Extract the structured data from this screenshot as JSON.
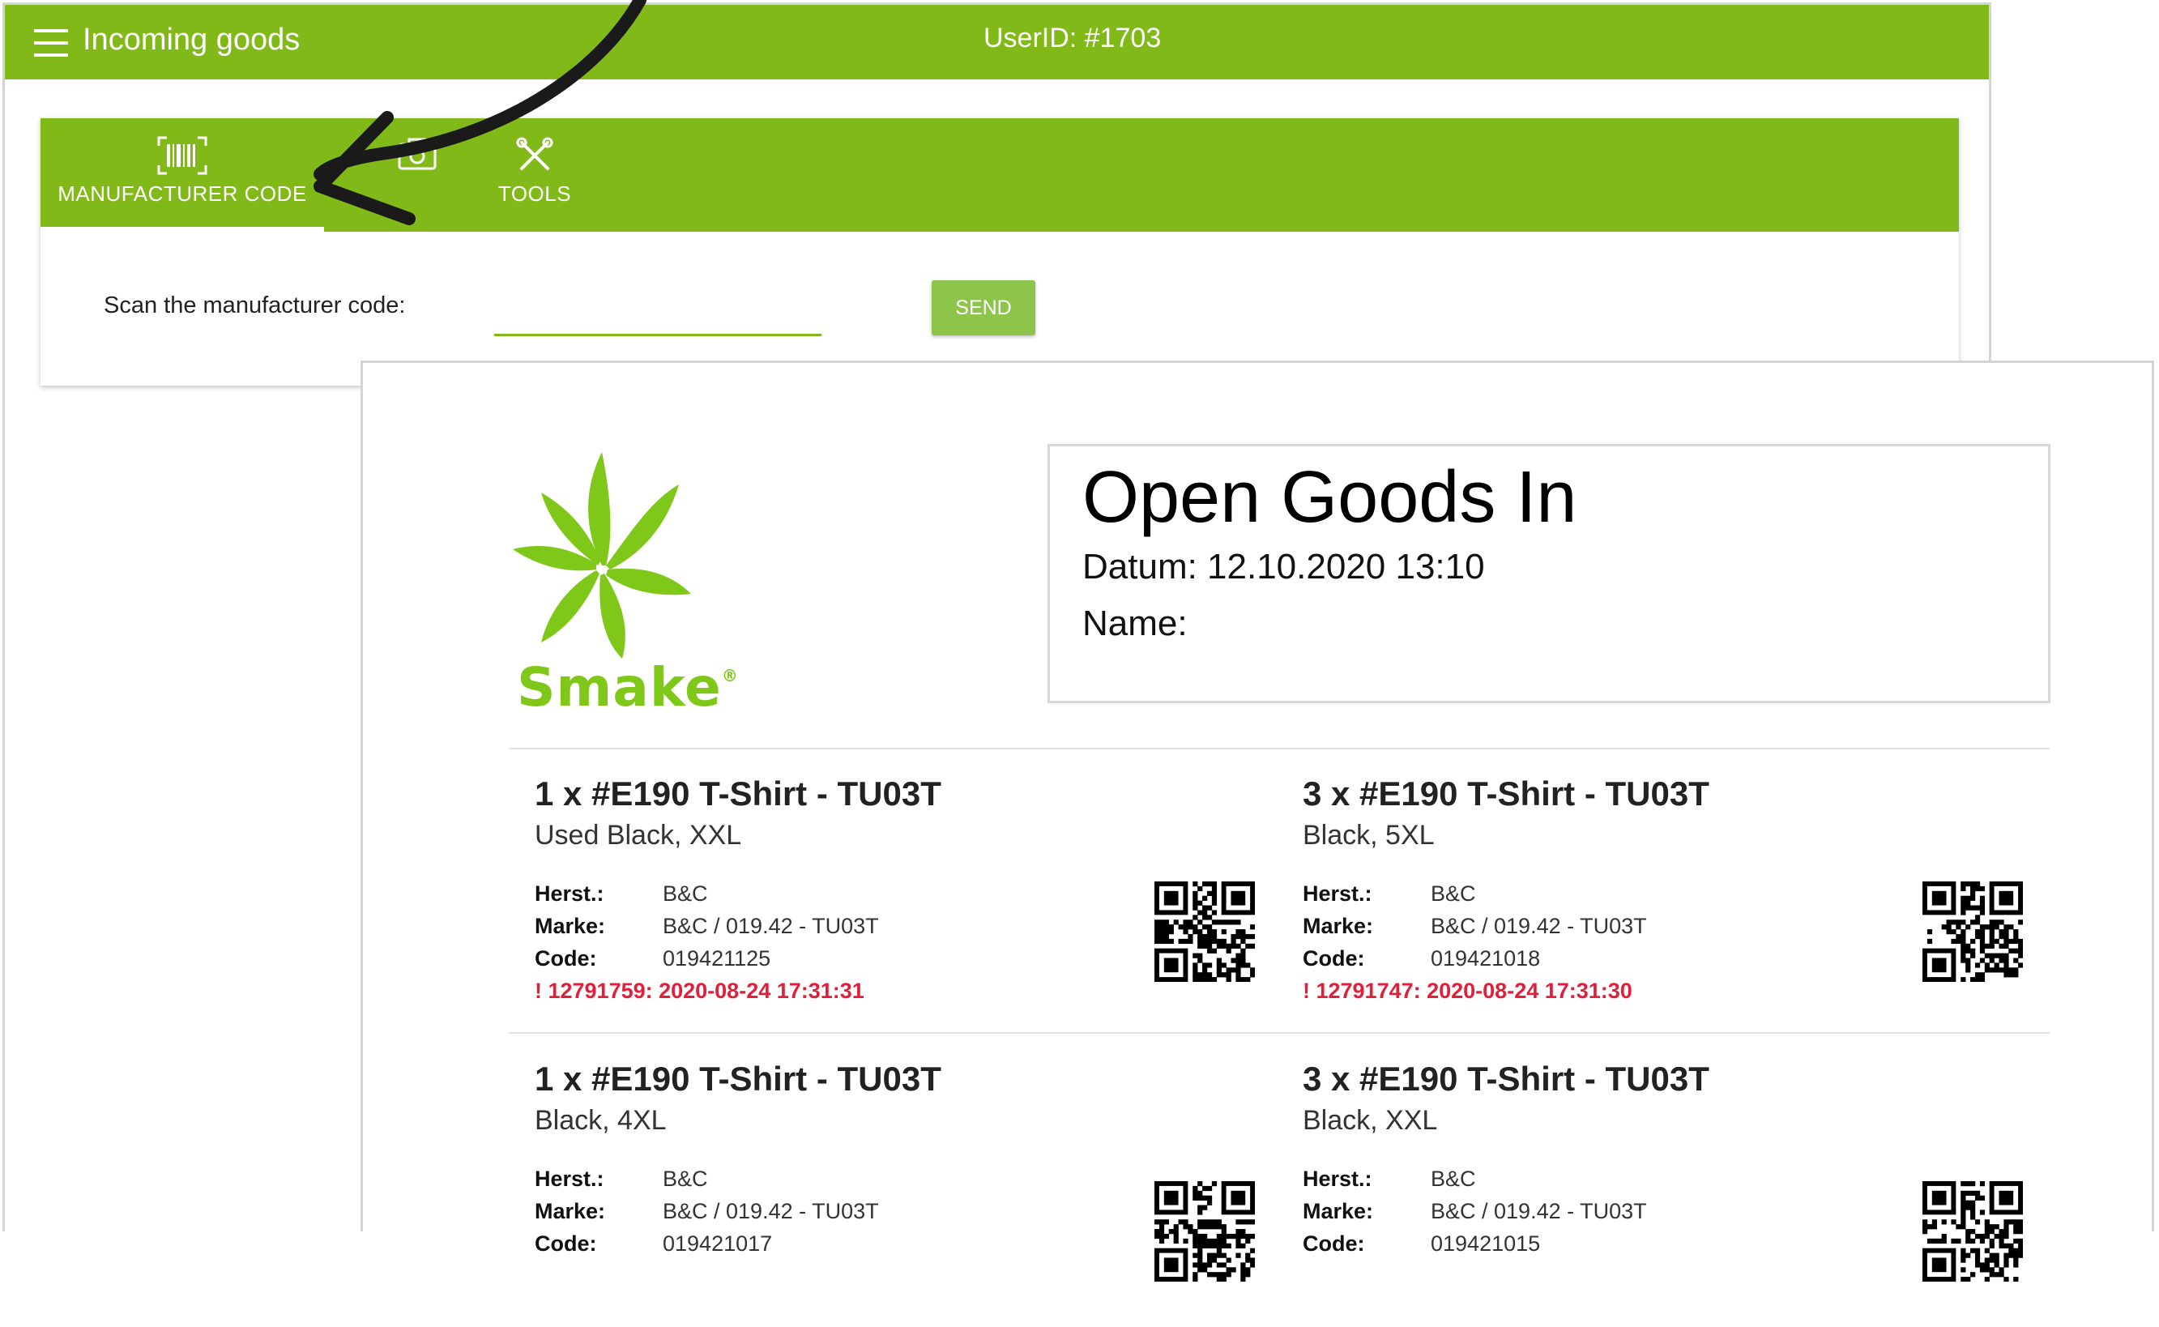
{
  "app": {
    "title": "Incoming goods",
    "user_id": "UserID: #1703"
  },
  "tabs": [
    {
      "label": "MANUFACTURER CODE",
      "icon": "barcode-icon",
      "active": true
    },
    {
      "label": "TOOLS",
      "icon": "tools-icon",
      "active": false
    }
  ],
  "scan": {
    "label": "Scan the manufacturer code:",
    "value": "",
    "send_label": "SEND"
  },
  "colors": {
    "brand": "#80b918",
    "button": "#8dc44a",
    "warning": "#e0203a",
    "logo": "#7fc81a"
  },
  "document": {
    "logo_text": "Smake",
    "title": "Open Goods In",
    "date": "Datum: 12.10.2020 13:10",
    "name": "Name:",
    "items": [
      {
        "title": "1 x #E190 T-Shirt - TU03T",
        "variant": "Used Black, XXL",
        "herst_label": "Herst.:",
        "herst": "B&C",
        "marke_label": "Marke:",
        "marke": "B&C / 019.42 - TU03T",
        "code_label": "Code:",
        "code": "019421125",
        "warning": "! 12791759: 2020-08-24 17:31:31"
      },
      {
        "title": "3 x #E190 T-Shirt - TU03T",
        "variant": "Black, 5XL",
        "herst_label": "Herst.:",
        "herst": "B&C",
        "marke_label": "Marke:",
        "marke": "B&C / 019.42 - TU03T",
        "code_label": "Code:",
        "code": "019421018",
        "warning": "! 12791747: 2020-08-24 17:31:30"
      },
      {
        "title": "1 x #E190 T-Shirt - TU03T",
        "variant": "Black, 4XL",
        "herst_label": "Herst.:",
        "herst": "B&C",
        "marke_label": "Marke:",
        "marke": "B&C / 019.42 - TU03T",
        "code_label": "Code:",
        "code": "019421017"
      },
      {
        "title": "3 x #E190 T-Shirt - TU03T",
        "variant": "Black, XXL",
        "herst_label": "Herst.:",
        "herst": "B&C",
        "marke_label": "Marke:",
        "marke": "B&C / 019.42 - TU03T",
        "code_label": "Code:",
        "code": "019421015"
      }
    ]
  }
}
